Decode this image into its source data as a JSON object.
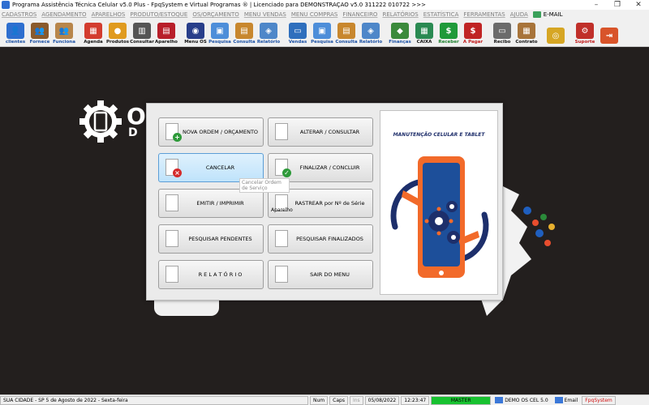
{
  "window": {
    "title": "Programa Assistência Técnica Celular v5.0 Plus - FpqSystem e Virtual Programas ® | Licenciado para  DEMONSTRAÇÃO v5.0 311222 010722 >>>",
    "minimize": "–",
    "maximize": "❐",
    "close": "✕"
  },
  "menu": [
    "CADASTROS",
    "AGENDAMENTO",
    "APARELHOS",
    "PRODUTO/ESTOQUE",
    "OS/ORÇAMENTO",
    "MENU VENDAS",
    "MENU COMPRAS",
    "FINANCEIRO",
    "RELATÓRIOS",
    "ESTATÍSTICA",
    "FERRAMENTAS",
    "AJUDA"
  ],
  "menu_email": "E-MAIL",
  "toolbar": [
    {
      "label": "clientes",
      "color": "#2e6fcf",
      "glyph": "👤",
      "lclass": "blue"
    },
    {
      "label": "Fornece",
      "color": "#8a5a2c",
      "glyph": "👥",
      "lclass": "blue"
    },
    {
      "label": "Funciona",
      "color": "#b8864b",
      "glyph": "👥",
      "lclass": "blue"
    },
    {
      "label": "Agenda",
      "color": "#d33c2f",
      "glyph": "▦",
      "lclass": ""
    },
    {
      "label": "Produtos",
      "color": "#e09b1f",
      "glyph": "●",
      "lclass": ""
    },
    {
      "label": "Consultar",
      "color": "#555555",
      "glyph": "▥",
      "lclass": ""
    },
    {
      "label": "Aparelho",
      "color": "#b81f2a",
      "glyph": "▤",
      "lclass": ""
    },
    {
      "label": "Menu OS",
      "color": "#283e8a",
      "glyph": "◉",
      "lclass": ""
    },
    {
      "label": "Pesquisa",
      "color": "#4d8ed9",
      "glyph": "▣",
      "lclass": "blue"
    },
    {
      "label": "Consulta",
      "color": "#c8872e",
      "glyph": "▤",
      "lclass": "blue"
    },
    {
      "label": "Relatório",
      "color": "#4e87c9",
      "glyph": "◈",
      "lclass": "blue"
    },
    {
      "label": "Vendas",
      "color": "#2f6fbd",
      "glyph": "▭",
      "lclass": "blue"
    },
    {
      "label": "Pesquisa",
      "color": "#4d8ed9",
      "glyph": "▣",
      "lclass": "blue"
    },
    {
      "label": "Consulta",
      "color": "#c8872e",
      "glyph": "▤",
      "lclass": "blue"
    },
    {
      "label": "Relatório",
      "color": "#4e87c9",
      "glyph": "◈",
      "lclass": "blue"
    },
    {
      "label": "Finanças",
      "color": "#3b8a3b",
      "glyph": "◆",
      "lclass": "blue"
    },
    {
      "label": "CAIXA",
      "color": "#2a8a52",
      "glyph": "▦",
      "lclass": ""
    },
    {
      "label": "Receber",
      "color": "#1f9a3a",
      "glyph": "$",
      "lclass": "green"
    },
    {
      "label": "A Pagar",
      "color": "#c02424",
      "glyph": "$",
      "lclass": "red"
    },
    {
      "label": "Recibo",
      "color": "#6b6b6b",
      "glyph": "▭",
      "lclass": ""
    },
    {
      "label": "Contrato",
      "color": "#a8743a",
      "glyph": "▦",
      "lclass": ""
    },
    {
      "label": "",
      "color": "#d6a624",
      "glyph": "◎",
      "lclass": ""
    },
    {
      "label": "Suporte",
      "color": "#c0302a",
      "glyph": "⚙",
      "lclass": "red"
    },
    {
      "label": "",
      "color": "#d8542a",
      "glyph": "⇥",
      "lclass": ""
    }
  ],
  "logo": {
    "line1": "O",
    "line2": "D O"
  },
  "dialog": {
    "buttons": [
      {
        "label": "NOVA ORDEM / ORÇAMENTO",
        "name": "nova-ordem-button",
        "icon": "doc-add-icon",
        "badge": "+",
        "badge_color": "#2e9a3a",
        "col": 0,
        "row": 0
      },
      {
        "label": "ALTERAR  /  CONSULTAR",
        "name": "alterar-consultar-button",
        "icon": "edit-icon",
        "badge": "",
        "badge_color": "",
        "col": 1,
        "row": 0
      },
      {
        "label": "CANCELAR",
        "name": "cancelar-button",
        "icon": "doc-cancel-icon",
        "badge": "×",
        "badge_color": "#d42a2a",
        "col": 0,
        "row": 1,
        "hover": true
      },
      {
        "label": "FINALIZAR  /  CONCLUIR",
        "name": "finalizar-concluir-button",
        "icon": "doc-check-icon",
        "badge": "✓",
        "badge_color": "#2e9a3a",
        "col": 1,
        "row": 1
      },
      {
        "label": "EMITIR  /  IMPRIMIR",
        "name": "emitir-imprimir-button",
        "icon": "print-icon",
        "badge": "",
        "badge_color": "",
        "col": 0,
        "row": 2
      },
      {
        "label": "RASTREAR por Nº de Série",
        "name": "rastrear-serie-button",
        "icon": "device-icon",
        "badge": "",
        "badge_color": "",
        "col": 1,
        "row": 2
      },
      {
        "label": "PESQUISAR PENDENTES",
        "name": "pesquisar-pendentes-button",
        "icon": "tools-icon",
        "badge": "",
        "badge_color": "",
        "col": 0,
        "row": 3
      },
      {
        "label": "PESQUISAR FINALIZADOS",
        "name": "pesquisar-finalizados-button",
        "icon": "tools-check-icon",
        "badge": "",
        "badge_color": "",
        "col": 1,
        "row": 3
      },
      {
        "label": "R E L A T Ó R I O",
        "name": "relatorio-button",
        "icon": "report-icon",
        "badge": "",
        "badge_color": "",
        "col": 0,
        "row": 4
      },
      {
        "label": "SAIR DO MENU",
        "name": "sair-menu-button",
        "icon": "exit-icon",
        "badge": "",
        "badge_color": "",
        "col": 1,
        "row": 4
      }
    ],
    "tooltip": "Cancelar Ordem de Serviço",
    "aparelho_label": "Aparelho",
    "side_title": "MANUTENÇÃO CELULAR E TABLET"
  },
  "status": {
    "city": "SUA CIDADE - SP  5 de Agosto de 2022 - Sexta-feira",
    "num": "Num",
    "caps": "Caps",
    "ins": "Ins",
    "date": "05/08/2022",
    "time": "12:23:47",
    "master": "MASTER",
    "db": "DEMO OS CEL 5.0",
    "email": "Email",
    "brand": "FpqSystem"
  }
}
